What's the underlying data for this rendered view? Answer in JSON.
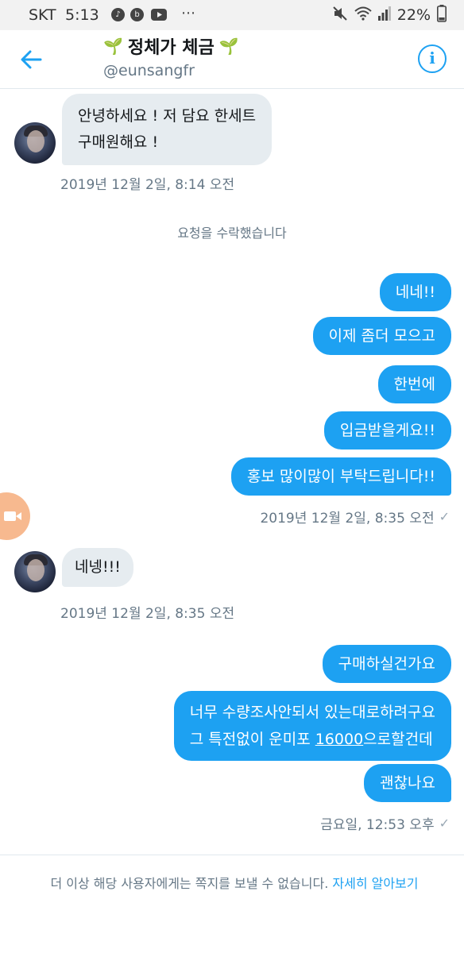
{
  "status_bar": {
    "carrier": "SKT",
    "time": "5:13",
    "more_indicator": "⋯",
    "battery_percent": "22%",
    "icons": [
      "music-note-icon",
      "b-app-icon",
      "youtube-icon",
      "mute-icon",
      "wifi-icon",
      "signal-icon",
      "battery-icon"
    ]
  },
  "header": {
    "display_name": "정체가 체금",
    "sprout_left": "🌱",
    "sprout_right": "🌱",
    "handle": "@eunsangfr",
    "info_glyph": "i",
    "accent_color": "#1da1f2"
  },
  "messages": [
    {
      "direction": "in",
      "text_lines": [
        "안녕하세요 ! 저 담요 한세트",
        "구매원해요 !"
      ]
    },
    {
      "direction": "in_meta",
      "timestamp": "2019년 12월 2일, 8:14 오전"
    },
    {
      "direction": "system",
      "text": "요청을 수락했습니다"
    },
    {
      "direction": "out",
      "text": "네네!!"
    },
    {
      "direction": "out",
      "text": "이제 좀더 모으고"
    },
    {
      "direction": "out",
      "text": "한번에"
    },
    {
      "direction": "out",
      "text": "입금받을게요!!"
    },
    {
      "direction": "out",
      "text": "홍보 많이많이 부탁드립니다!!"
    },
    {
      "direction": "out_meta",
      "timestamp": "2019년 12월 2일, 8:35 오전",
      "read_mark": "✓"
    },
    {
      "direction": "in",
      "text": "네넹!!!"
    },
    {
      "direction": "in_meta",
      "timestamp": "2019년 12월 2일, 8:35 오전"
    },
    {
      "direction": "out",
      "text": "구매하실건가요"
    },
    {
      "direction": "out",
      "line1": "너무 수량조사안되서 있는대로하려구요",
      "line2_pre": "그  특전없이 운미포 ",
      "line2_num": "16000",
      "line2_post": "으로할건데"
    },
    {
      "direction": "out",
      "text": "괜찮나요"
    },
    {
      "direction": "out_meta",
      "timestamp": "금요일, 12:53 오후",
      "read_mark": "✓"
    }
  ],
  "footer": {
    "notice": "더 이상 해당 사용자에게는 쪽지를 보낼 수 없습니다.",
    "link_label": "자세히 알아보기"
  },
  "colors": {
    "outgoing_bubble": "#1da1f2",
    "incoming_bubble": "#e6ecf0",
    "meta_text": "#657786",
    "video_button": "#f7b98f"
  }
}
